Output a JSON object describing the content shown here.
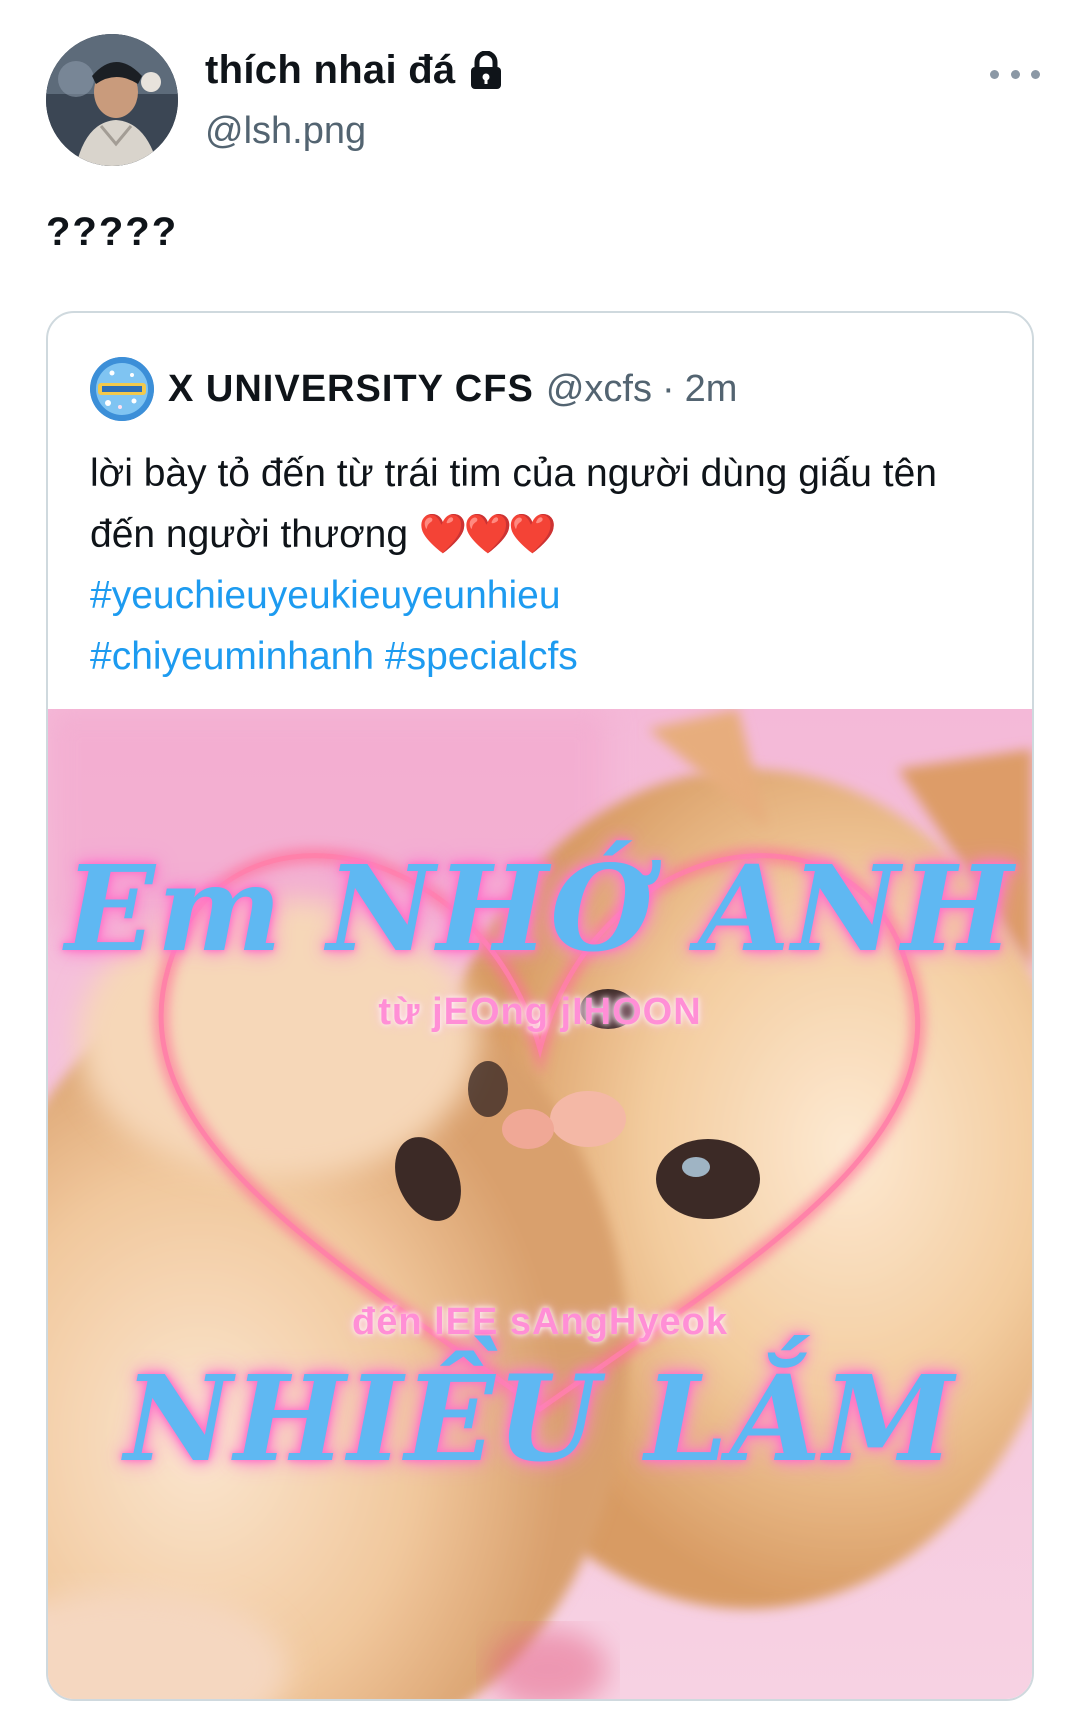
{
  "author": {
    "display_name": "thích nhai đá",
    "handle": "@lsh.png",
    "avatar_icon": "profile-photo",
    "protected_icon": "lock-icon"
  },
  "tweet": {
    "text": "?????"
  },
  "quoted_tweet": {
    "display_name": "X UNIVERSITY CFS",
    "handle": "@xcfs",
    "separator": "·",
    "time": "2m",
    "text": "lời bày tỏ đến từ trái tim của người dùng giấu tên đến người thương",
    "emoji": "❤️❤️❤️",
    "hashtags": [
      "#yeuchieuyeukieuyeunhieu",
      "#chiyeuminhanh",
      "#specialcfs"
    ],
    "image": {
      "headline_top": "Em NHỚ ANH",
      "from_line": "từ jEOng jIHOON",
      "to_line": "đến lEE sAngHyeok",
      "headline_bottom": "NHIỀU LẮM"
    }
  },
  "colors": {
    "link": "#1d9bf0",
    "secondary_text": "#536471",
    "border": "#cfd9de",
    "overlay_blue": "#5fb8f2",
    "overlay_pink": "#ff8fd6"
  }
}
